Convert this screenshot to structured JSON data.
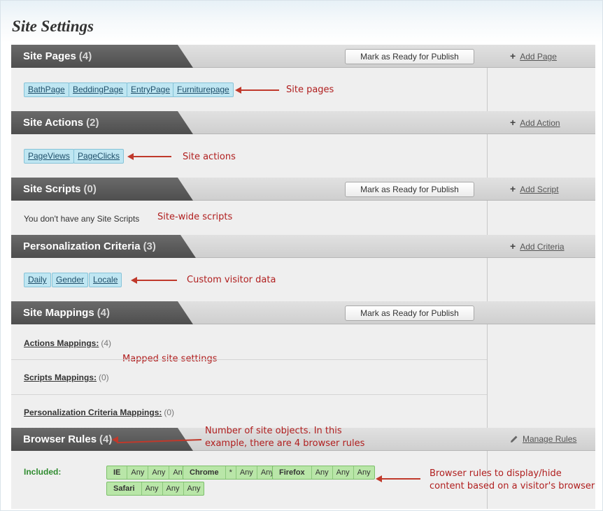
{
  "page_title": "Site Settings",
  "publish_label": "Mark as Ready for Publish",
  "sections": {
    "pages": {
      "title": "Site Pages",
      "count": "(4)",
      "action": "Add Page"
    },
    "actions": {
      "title": "Site Actions",
      "count": "(2)",
      "action": "Add Action"
    },
    "scripts": {
      "title": "Site Scripts",
      "count": "(0)",
      "action": "Add Script"
    },
    "criteria": {
      "title": "Personalization Criteria",
      "count": "(3)",
      "action": "Add Criteria"
    },
    "mappings": {
      "title": "Site Mappings",
      "count": "(4)"
    },
    "browser": {
      "title": "Browser Rules",
      "count": "(4)",
      "action": "Manage Rules"
    }
  },
  "pages": [
    "BathPage",
    "BeddingPage",
    "EntryPage",
    "Furniturepage"
  ],
  "actions": [
    "PageViews",
    "PageClicks"
  ],
  "scripts_empty": "You don't have any Site Scripts",
  "criteria": [
    "Daily",
    "Gender",
    "Locale"
  ],
  "mappings": [
    {
      "label": "Actions Mappings:",
      "count": "(4)"
    },
    {
      "label": "Scripts Mappings:",
      "count": "(0)"
    },
    {
      "label": "Personalization Criteria Mappings:",
      "count": "(0)"
    }
  ],
  "included_label": "Included:",
  "browser_rules": [
    [
      "IE",
      "Any",
      "Any",
      "Any"
    ],
    [
      "Chrome",
      "*",
      "Any",
      "Any"
    ],
    [
      "Firefox",
      "Any",
      "Any",
      "Any"
    ],
    [
      "Safari",
      "Any",
      "Any",
      "Any"
    ]
  ],
  "annotations": {
    "pages": "Site pages",
    "actions": "Site actions",
    "scripts": "Site-wide scripts",
    "criteria": "Custom visitor data",
    "mappings": "Mapped site settings",
    "count_line1": "Number of site objects. In this",
    "count_line2": "example, there are 4 browser rules",
    "browser_line1": "Browser rules to display/hide",
    "browser_line2": "content based on a visitor's browser"
  },
  "colors": {
    "annotation": "#b01e1e",
    "chip_blue": "#bfe6f2",
    "chip_green": "#b9e6a8",
    "header_tab": "#5a5a5a",
    "included_green": "#2e8b2e"
  }
}
